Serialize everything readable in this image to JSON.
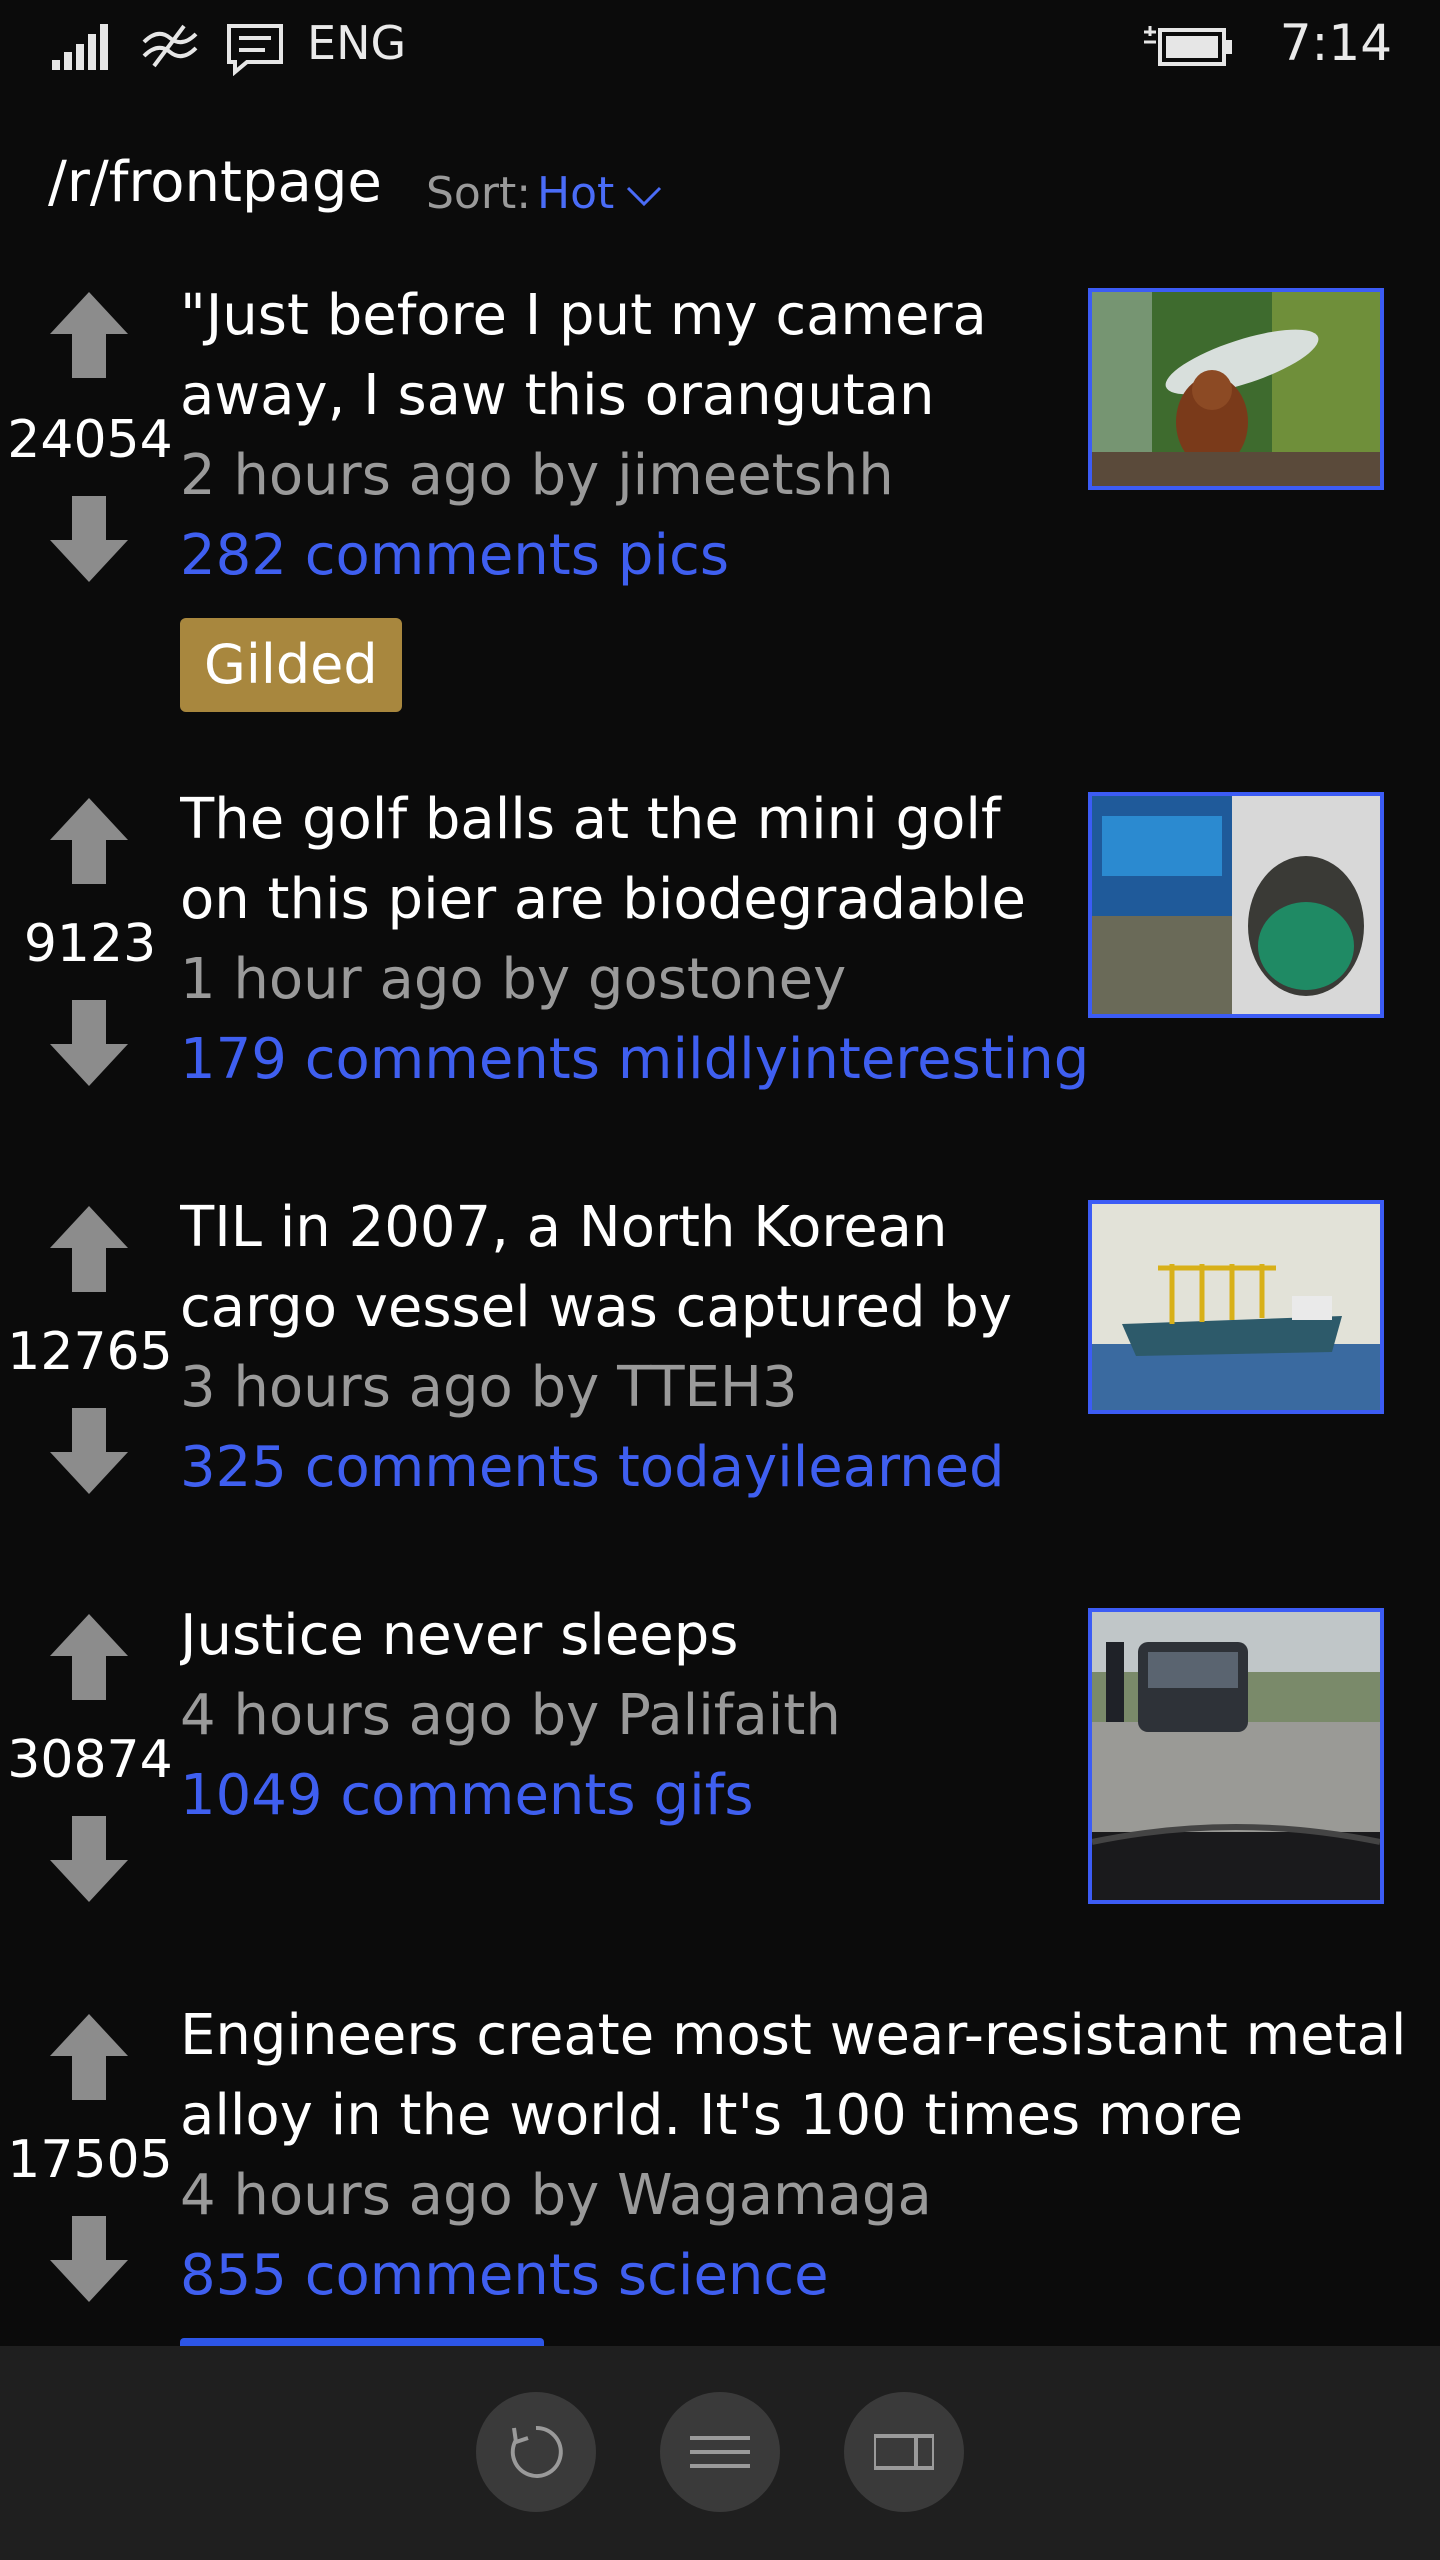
{
  "status_bar": {
    "language": "ENG",
    "time": "7:14",
    "icons": [
      "signal-icon",
      "wifi-icon",
      "message-icon",
      "battery-icon"
    ]
  },
  "header": {
    "subreddit": "/r/frontpage",
    "sort_label": "Sort:",
    "sort_value": "Hot"
  },
  "posts": [
    {
      "score": "24054",
      "title": "\"Just before I put my camera away, I saw this orangutan take",
      "meta": "2 hours ago by jimeetshh",
      "comments": "282 comments",
      "subreddit": "pics",
      "badge": "Gilded"
    },
    {
      "score": "9123",
      "title": "The golf balls at the mini golf on this pier are biodegradable and",
      "meta": "1 hour ago by gostoney",
      "comments": "179 comments",
      "subreddit": "mildlyinteresting"
    },
    {
      "score": "12765",
      "title": "TIL in 2007, a North Korean cargo vessel was captured by",
      "meta": "3 hours ago by TTEH3",
      "comments": "325 comments",
      "subreddit": "todayilearned"
    },
    {
      "score": "30874",
      "title": "Justice never sleeps",
      "meta": "4 hours ago by Palifaith",
      "comments": "1049 comments",
      "subreddit": "gifs"
    },
    {
      "score": "17505",
      "title": "Engineers create most wear-resistant metal alloy in the world. It's 100 times more",
      "meta": "4 hours ago by Wagamaga",
      "comments": "855 comments",
      "subreddit": "science"
    }
  ],
  "app_bar": {
    "buttons": [
      "refresh-icon",
      "menu-icon",
      "panel-icon"
    ]
  },
  "colors": {
    "background": "#0b0b0b",
    "accent_link": "#3f5ff0",
    "meta_gray": "#9a9a9a",
    "gilded": "#a8873e",
    "thumb_border": "#3c5cf5",
    "app_bar": "#1f1f1f"
  }
}
